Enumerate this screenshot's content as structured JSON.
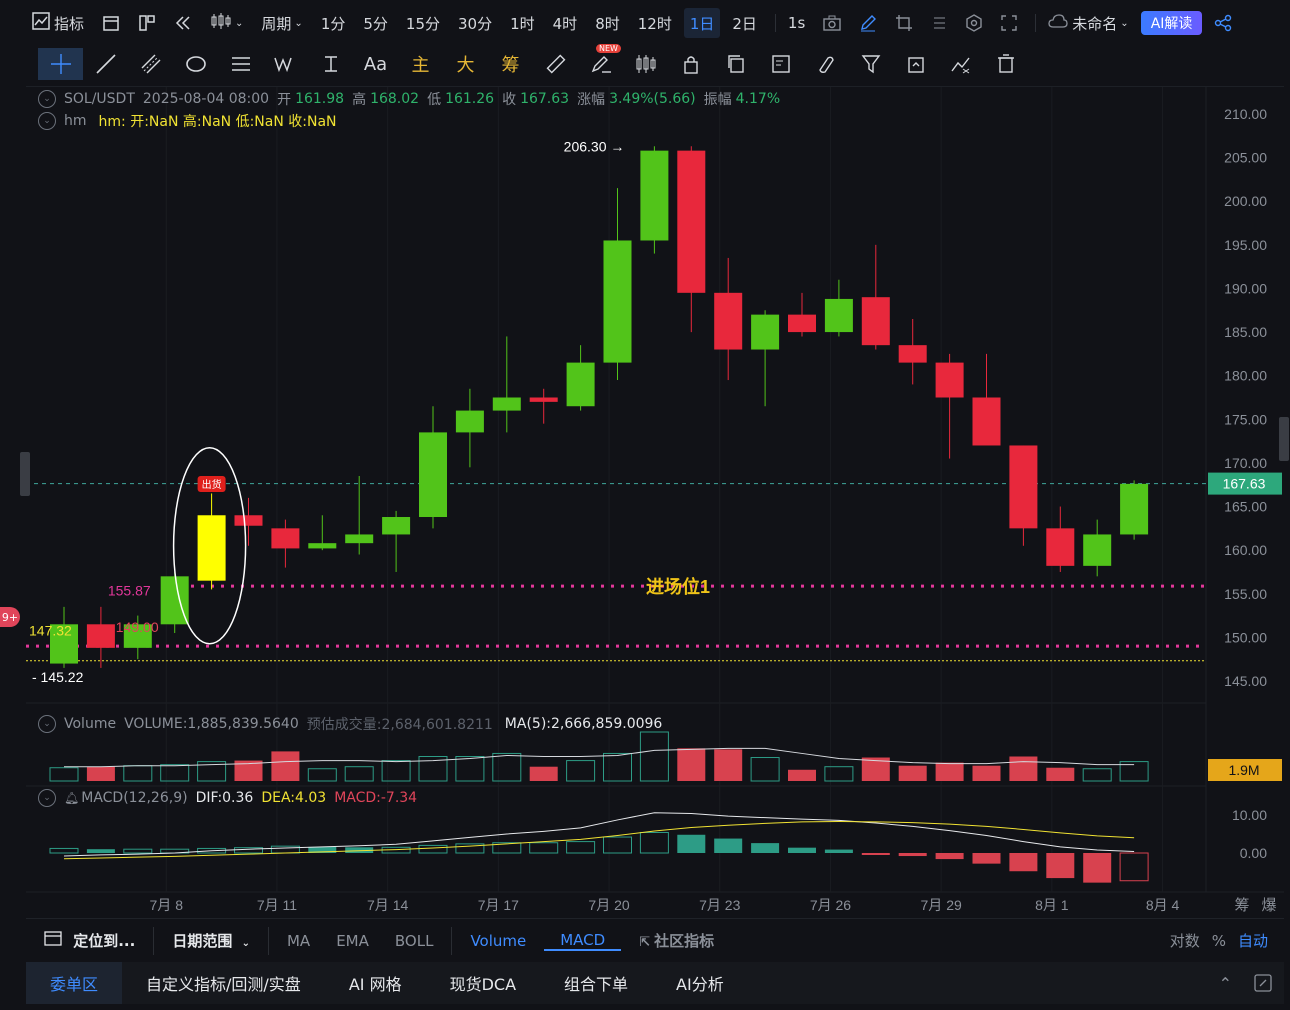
{
  "topbar": {
    "indicators_label": "指标",
    "period_label": "周期",
    "intervals": [
      "1分",
      "5分",
      "15分",
      "30分",
      "1时",
      "4时",
      "8时",
      "12时",
      "1日",
      "2日"
    ],
    "active_interval": "1日",
    "sec_label": "1s",
    "layout_name": "未命名",
    "ai_label": "AI解读"
  },
  "drawbar": {
    "font_tool": "Aa",
    "cn_tools": [
      "主",
      "大",
      "筹"
    ],
    "new_badge": "NEW"
  },
  "symbol_info": {
    "symbol": "SOL/USDT",
    "datetime": "2025-08-04 08:00",
    "open_label": "开",
    "open": "161.98",
    "high_label": "高",
    "high": "168.02",
    "low_label": "低",
    "low": "161.26",
    "close_label": "收",
    "close": "167.63",
    "change_label": "涨幅",
    "change": "3.49%(5.66)",
    "amp_label": "振幅",
    "amp": "4.17%"
  },
  "hm_info": {
    "name": "hm",
    "text": "hm: 开:NaN 高:NaN 低:NaN 收:NaN"
  },
  "volume_info": {
    "name": "Volume",
    "volume_text": "VOLUME:1,885,839.5640",
    "estimate_text": "预估成交量:2,684,601.8211",
    "ma_text": "MA(5):2,666,859.0096",
    "last_label": "1.9M"
  },
  "macd_info": {
    "name": "MACD(12,26,9)",
    "dif": "DIF:0.36",
    "dea": "DEA:4.03",
    "macd": "MACD:-7.34"
  },
  "chart_data": {
    "type": "candlestick",
    "price_axis_ticks": [
      "210.00",
      "205.00",
      "200.00",
      "195.00",
      "190.00",
      "185.00",
      "180.00",
      "175.00",
      "170.00",
      "165.00",
      "160.00",
      "155.00",
      "150.00",
      "145.00"
    ],
    "current_price": "167.63",
    "price_range": [
      144,
      211
    ],
    "candles": [
      {
        "o": 147.0,
        "h": 153.5,
        "l": 146.5,
        "c": 151.5
      },
      {
        "o": 151.5,
        "h": 153.5,
        "l": 146.5,
        "c": 148.8
      },
      {
        "o": 148.8,
        "h": 152.5,
        "l": 147.5,
        "c": 151.5
      },
      {
        "o": 151.5,
        "h": 157.5,
        "l": 150.5,
        "c": 157.0
      },
      {
        "o": 156.5,
        "h": 166.5,
        "l": 155.5,
        "c": 164.0
      },
      {
        "o": 164.0,
        "h": 166.0,
        "l": 160.5,
        "c": 162.8
      },
      {
        "o": 162.5,
        "h": 163.5,
        "l": 158.0,
        "c": 160.2
      },
      {
        "o": 160.2,
        "h": 164.0,
        "l": 160.0,
        "c": 160.8
      },
      {
        "o": 160.8,
        "h": 168.5,
        "l": 159.5,
        "c": 161.8
      },
      {
        "o": 161.8,
        "h": 164.5,
        "l": 157.5,
        "c": 163.8
      },
      {
        "o": 163.8,
        "h": 176.5,
        "l": 162.5,
        "c": 173.5
      },
      {
        "o": 173.5,
        "h": 178.5,
        "l": 169.5,
        "c": 176.0
      },
      {
        "o": 176.0,
        "h": 184.5,
        "l": 173.5,
        "c": 177.5
      },
      {
        "o": 177.5,
        "h": 178.5,
        "l": 174.5,
        "c": 177.0
      },
      {
        "o": 176.5,
        "h": 183.5,
        "l": 176.0,
        "c": 181.5
      },
      {
        "o": 181.5,
        "h": 201.5,
        "l": 179.5,
        "c": 195.5
      },
      {
        "o": 195.5,
        "h": 206.3,
        "l": 194.0,
        "c": 205.8
      },
      {
        "o": 205.8,
        "h": 206.3,
        "l": 185.0,
        "c": 189.5
      },
      {
        "o": 189.5,
        "h": 193.5,
        "l": 179.5,
        "c": 183.0
      },
      {
        "o": 183.0,
        "h": 187.5,
        "l": 176.5,
        "c": 187.0
      },
      {
        "o": 187.0,
        "h": 189.5,
        "l": 184.5,
        "c": 185.0
      },
      {
        "o": 185.0,
        "h": 191.0,
        "l": 184.5,
        "c": 188.8
      },
      {
        "o": 189.0,
        "h": 195.0,
        "l": 183.0,
        "c": 183.5
      },
      {
        "o": 183.5,
        "h": 186.5,
        "l": 179.0,
        "c": 181.5
      },
      {
        "o": 181.5,
        "h": 182.5,
        "l": 170.5,
        "c": 177.5
      },
      {
        "o": 177.5,
        "h": 182.5,
        "l": 172.5,
        "c": 172.0
      },
      {
        "o": 172.0,
        "h": 172.0,
        "l": 160.5,
        "c": 162.5
      },
      {
        "o": 162.5,
        "h": 165.0,
        "l": 157.5,
        "c": 158.2
      },
      {
        "o": 158.2,
        "h": 163.5,
        "l": 157.0,
        "c": 161.8
      },
      {
        "o": 161.8,
        "h": 168.0,
        "l": 161.2,
        "c": 167.6
      }
    ],
    "volume": [
      1.3,
      1.4,
      1.5,
      1.6,
      1.9,
      2.0,
      2.9,
      1.2,
      1.4,
      2.0,
      2.4,
      2.4,
      2.7,
      1.4,
      2.0,
      2.7,
      4.8,
      3.2,
      3.1,
      2.3,
      1.1,
      1.4,
      2.3,
      1.5,
      1.8,
      1.5,
      2.4,
      1.3,
      1.2,
      1.9
    ],
    "volume_ma": [
      1.4,
      1.4,
      1.5,
      1.5,
      1.6,
      1.7,
      1.9,
      2.0,
      2.0,
      1.9,
      2.0,
      2.2,
      2.5,
      2.4,
      2.4,
      2.5,
      3.0,
      3.1,
      3.2,
      3.2,
      2.7,
      2.2,
      2.0,
      1.8,
      1.7,
      1.7,
      1.9,
      1.8,
      1.6,
      1.6
    ],
    "macd_hist": [
      1.2,
      1.0,
      1.0,
      1.0,
      1.2,
      1.4,
      1.8,
      1.6,
      1.5,
      1.5,
      2.0,
      2.4,
      2.7,
      2.7,
      3.0,
      4.2,
      5.4,
      4.8,
      3.8,
      2.6,
      1.4,
      0.9,
      -0.2,
      -0.8,
      -1.6,
      -2.8,
      -4.8,
      -6.6,
      -7.8,
      -7.3
    ],
    "dif": [
      -0.8,
      -0.5,
      -0.3,
      0.0,
      0.6,
      1.0,
      1.3,
      1.6,
      1.9,
      2.3,
      3.2,
      4.1,
      5.0,
      5.7,
      6.6,
      8.7,
      10.6,
      10.4,
      9.7,
      9.3,
      8.9,
      8.6,
      7.9,
      7.0,
      5.9,
      4.6,
      3.0,
      1.6,
      0.8,
      0.4
    ],
    "dea": [
      -1.5,
      -1.3,
      -1.1,
      -0.9,
      -0.6,
      -0.3,
      0.0,
      0.3,
      0.6,
      0.9,
      1.3,
      1.8,
      2.4,
      3.0,
      3.6,
      4.6,
      5.8,
      6.7,
      7.3,
      7.8,
      8.2,
      8.3,
      8.2,
      8.0,
      7.6,
      7.0,
      6.2,
      5.3,
      4.5,
      4.0
    ],
    "macd_axis_ticks": [
      "10.00",
      "0.00"
    ],
    "date_labels": [
      "7月 8",
      "7月 11",
      "7月 14",
      "7月 17",
      "7月 20",
      "7月 23",
      "7月 26",
      "7月 29",
      "8月 1",
      "8月 4"
    ],
    "annotations": {
      "high_label": "206.30",
      "low_label": "145.22",
      "left_price_1": "147.32",
      "left_price_2": "149.00",
      "level_label": "155.87",
      "entry_label": "进场位1",
      "signal_tag": "出货"
    }
  },
  "bottom_toolbar": {
    "locate": "定位到...",
    "date_range": "日期范围",
    "indicators": [
      "MA",
      "EMA",
      "BOLL",
      "Volume",
      "MACD"
    ],
    "community": "社区指标",
    "log_label": "对数",
    "pct_label": "%",
    "auto_label": "自动",
    "right_labels": [
      "筹",
      "爆"
    ]
  },
  "tabs": [
    "委单区",
    "自定义指标/回测/实盘",
    "AI 网格",
    "现货DCA",
    "组合下单",
    "AI分析"
  ],
  "left_badge": "9+",
  "colors": {
    "up": "#52c41a",
    "down": "#e8283c",
    "accent": "#3f8cff",
    "entry": "#e2379a",
    "signal": "#ffff00"
  }
}
